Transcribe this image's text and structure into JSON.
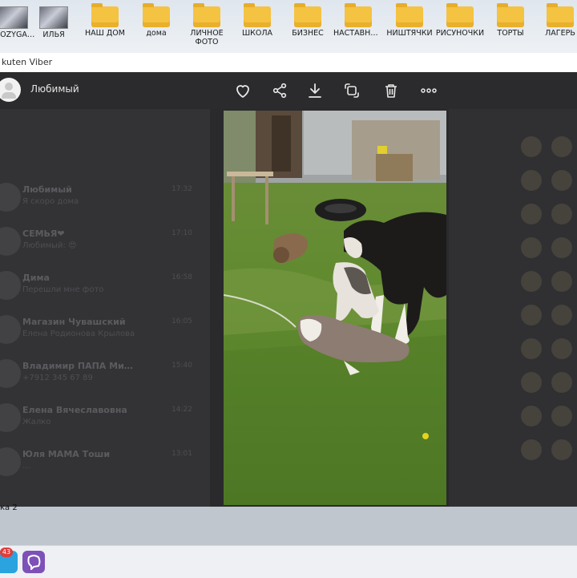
{
  "desktop": {
    "icons": [
      {
        "label": "…OZYGA…",
        "type": "thumb"
      },
      {
        "label": "ИЛЬЯ",
        "type": "thumb"
      },
      {
        "label": "НАШ ДОМ",
        "type": "folder"
      },
      {
        "label": "дома",
        "type": "folder"
      },
      {
        "label": "ЛИЧНОЕ ФОТО",
        "type": "folder"
      },
      {
        "label": "ШКОЛА",
        "type": "folder"
      },
      {
        "label": "БИЗНЕС",
        "type": "folder"
      },
      {
        "label": "НАСТАВНИ…",
        "type": "folder"
      },
      {
        "label": "НИШТЯЧКИ",
        "type": "folder"
      },
      {
        "label": "РИСУНОЧКИ",
        "type": "folder"
      },
      {
        "label": "ТОРТЫ",
        "type": "folder"
      },
      {
        "label": "ЛАГЕРЬ",
        "type": "folder"
      }
    ]
  },
  "window": {
    "title": "kuten Viber"
  },
  "viewer": {
    "contact_name": "Любимый",
    "actions": [
      "heart-icon",
      "share-icon",
      "download-icon",
      "forward-icon",
      "trash-icon",
      "more-icon"
    ]
  },
  "background_chats": [
    {
      "name": "Любимый",
      "preview": "Я скоро дома",
      "time": "17:32"
    },
    {
      "name": "СЕМЬЯ❤",
      "preview": "Любимый: 😍",
      "time": "17:10"
    },
    {
      "name": "Дима",
      "preview": "Перешли мне фото",
      "time": "16:58"
    },
    {
      "name": "Магазин Чувашский",
      "preview": "Елена Родионова Крылова…",
      "time": "16:05"
    },
    {
      "name": "Владимир ПАПА Ми…",
      "preview": "+7912 345 67 89",
      "time": "15:40"
    },
    {
      "name": "Елена Вячеславовна",
      "preview": "Жалко",
      "time": "14:22"
    },
    {
      "name": "Юля МАМА Тоши",
      "preview": "…",
      "time": "13:01"
    }
  ],
  "bottom": {
    "label": "ка 2"
  },
  "taskbar": {
    "telegram_badge": "43"
  },
  "colors": {
    "overlay": "#2b2b2d",
    "folder": "#f5c342",
    "viber": "#7d51b8",
    "telegram": "#2aa3df"
  }
}
